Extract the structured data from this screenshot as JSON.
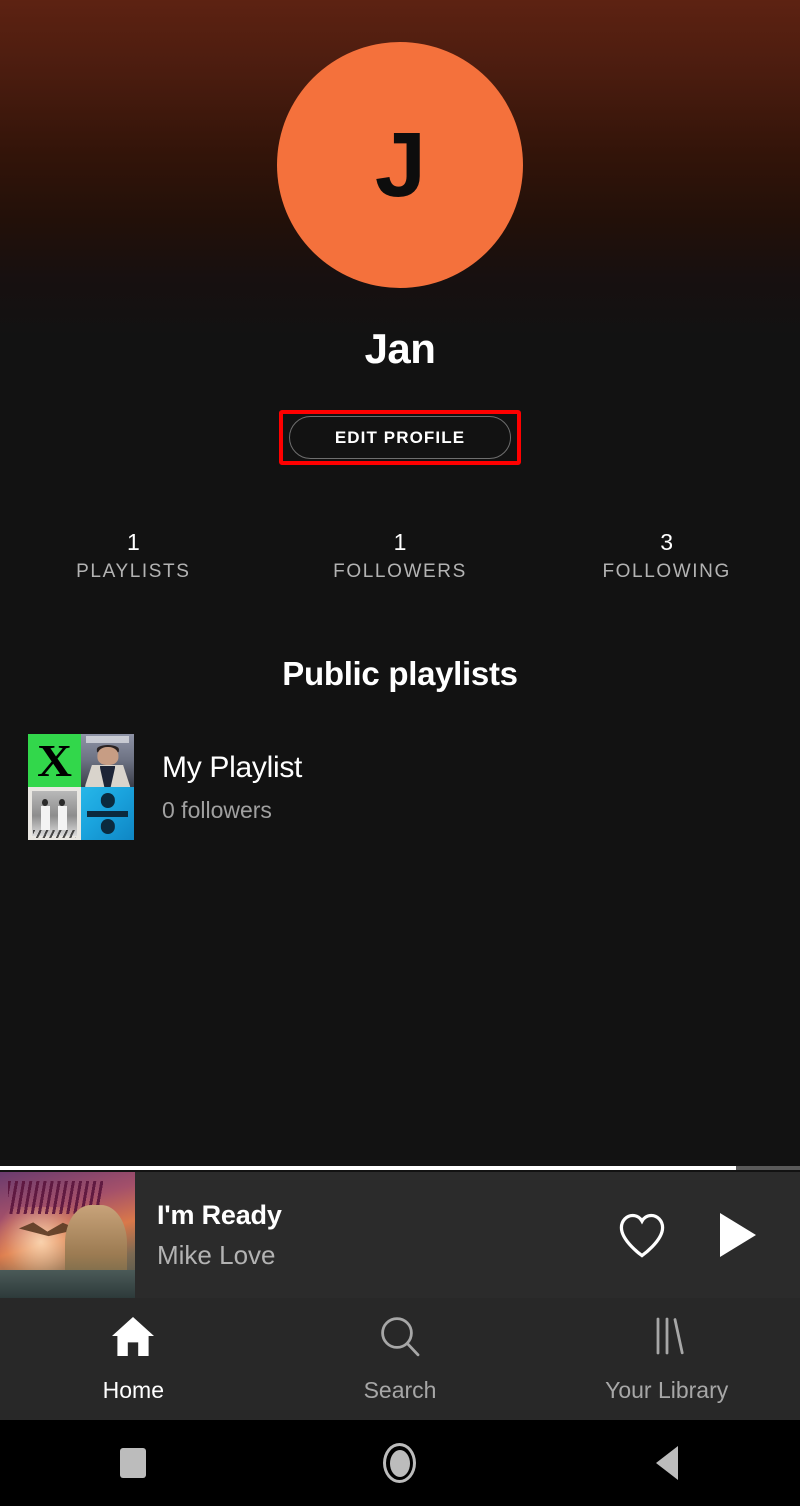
{
  "profile": {
    "avatar_letter": "J",
    "avatar_color": "#f4713c",
    "display_name": "Jan",
    "edit_button_label": "EDIT PROFILE",
    "highlight_color": "#ff0000",
    "stats": [
      {
        "value": "1",
        "label": "PLAYLISTS"
      },
      {
        "value": "1",
        "label": "FOLLOWERS"
      },
      {
        "value": "3",
        "label": "FOLLOWING"
      }
    ]
  },
  "playlists_section": {
    "title": "Public playlists",
    "items": [
      {
        "name": "My Playlist",
        "followers": "0 followers",
        "cover_tiles": [
          "green-x-album-art",
          "james-arthur-album-art",
          "black-white-photo-album-art",
          "blue-divide-album-art"
        ],
        "cover_glyph_x": "X"
      }
    ]
  },
  "now_playing": {
    "track_title": "I'm Ready",
    "artist": "Mike Love",
    "album_art": "mike-love-the-change-im-ready-cover",
    "progress_percent": 92,
    "like_icon": "heart-outline-icon",
    "play_icon": "play-icon"
  },
  "tabbar": {
    "tabs": [
      {
        "label": "Home",
        "icon": "home-icon",
        "active": true
      },
      {
        "label": "Search",
        "icon": "search-icon",
        "active": false
      },
      {
        "label": "Your Library",
        "icon": "library-icon",
        "active": false
      }
    ]
  },
  "system_nav": {
    "buttons": [
      {
        "name": "recents",
        "icon": "square-icon"
      },
      {
        "name": "home",
        "icon": "circle-icon"
      },
      {
        "name": "back",
        "icon": "triangle-left-icon"
      }
    ]
  }
}
